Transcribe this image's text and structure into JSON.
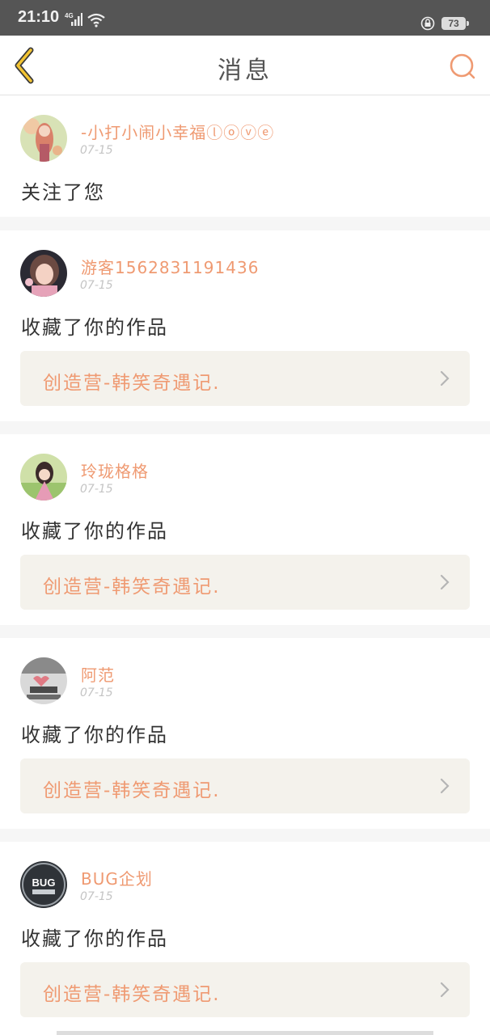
{
  "status_bar": {
    "time": "21:10",
    "network": "4G",
    "battery": "73",
    "icons": [
      "signal-icon",
      "wifi-icon",
      "lock-rotation-icon",
      "battery-icon"
    ]
  },
  "header": {
    "title": "消息",
    "back_icon": "chevron-left-icon",
    "search_icon": "search-icon"
  },
  "colors": {
    "accent": "#ef9a72",
    "back_arrow": "#f3c433",
    "card_box": "#f4f2ec",
    "status_bar": "#555555"
  },
  "messages": [
    {
      "username": "-小打小闹小幸福ⓛⓞⓥⓔ",
      "date": "07-15",
      "action": "关注了您"
    },
    {
      "username": "游客1562831191436",
      "date": "07-15",
      "action": "收藏了你的作品",
      "work_title": "创造营-韩笑奇遇记."
    },
    {
      "username": "玲珑格格",
      "date": "07-15",
      "action": "收藏了你的作品",
      "work_title": "创造营-韩笑奇遇记."
    },
    {
      "username": "阿范",
      "date": "07-15",
      "action": "收藏了你的作品",
      "work_title": "创造营-韩笑奇遇记."
    },
    {
      "username": "BUG企划",
      "date": "07-15",
      "action": "收藏了你的作品",
      "work_title": "创造营-韩笑奇遇记.",
      "avatar_text": "BUG"
    }
  ]
}
